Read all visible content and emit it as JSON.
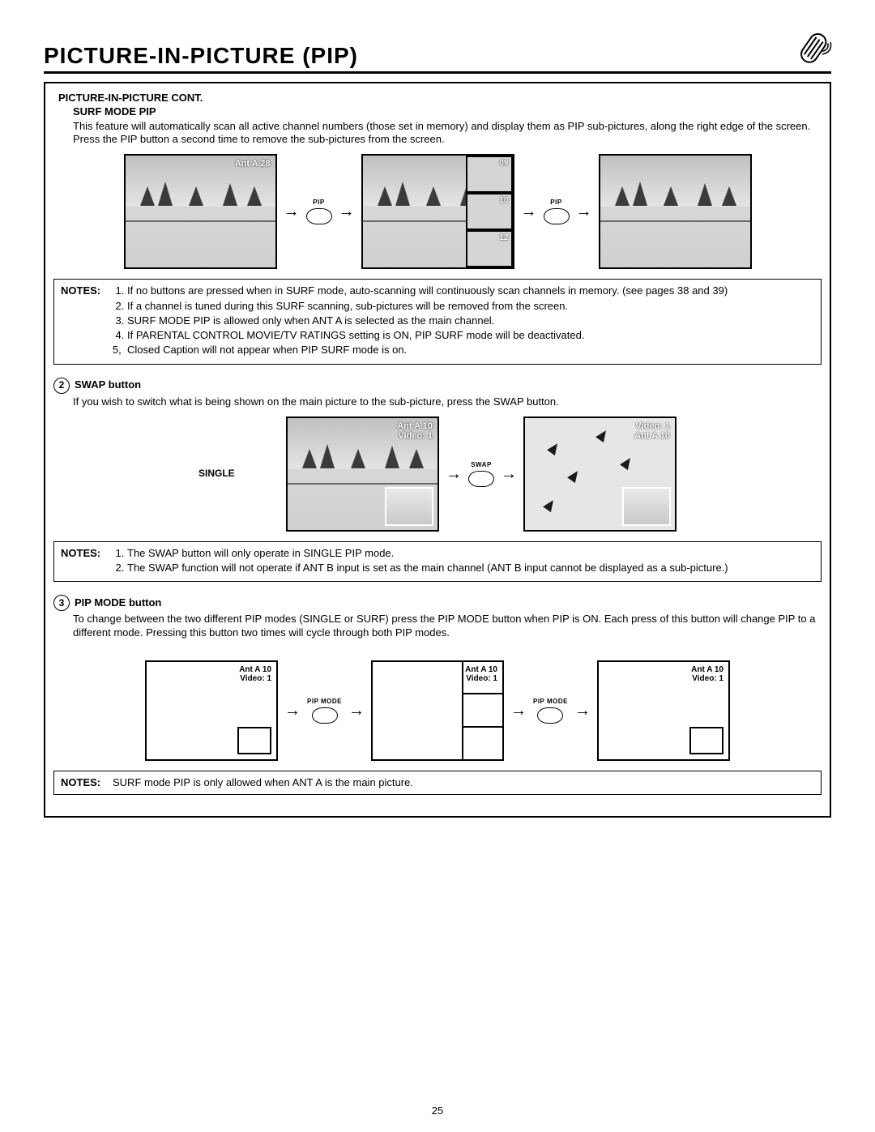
{
  "header": {
    "title": "PICTURE-IN-PICTURE (PIP)"
  },
  "section": {
    "heading": "PICTURE-IN-PICTURE CONT.",
    "subheading": "SURF MODE PIP",
    "intro": "This feature will automatically scan all active channel numbers (those set in memory) and display them as PIP sub-pictures, along the right edge of the screen.  Press the PIP button a second time to remove the sub-pictures from the screen."
  },
  "surf_fig": {
    "screen1_osd": "Ant A   28",
    "btn": "PIP",
    "strip": [
      "09",
      "10",
      "12"
    ]
  },
  "notes1": {
    "label": "NOTES:",
    "items": [
      "If no buttons are pressed when in SURF mode, auto-scanning will continuously scan channels in memory.  (see pages 38 and 39)",
      "If a channel is tuned during this SURF scanning, sub-pictures will be removed from the screen.",
      "SURF MODE PIP is allowed only when ANT A is selected as the main channel.",
      "If PARENTAL CONTROL MOVIE/TV RATINGS setting is ON, PIP SURF mode will be deactivated.",
      "Closed Caption will not appear when PIP SURF mode is on."
    ]
  },
  "swap": {
    "num": "2",
    "title": "SWAP button",
    "para": "If you wish to switch what is being shown on the main picture to the sub-picture, press the SWAP button.",
    "side": "SINGLE",
    "osd_a_line1": "Ant A 10",
    "osd_a_line2": "Video: 1",
    "osd_b_line1": "Video: 1",
    "osd_b_line2": "Ant  A 10",
    "btn": "SWAP"
  },
  "notes2": {
    "label": "NOTES:",
    "items": [
      "The SWAP button will only operate in SINGLE PIP mode.",
      "The SWAP function will not operate if ANT B input is set as the main channel (ANT B input cannot be displayed as a sub-picture.)"
    ]
  },
  "mode": {
    "num": "3",
    "title": "PIP MODE button",
    "para": "To change between the two different PIP modes (SINGLE or SURF) press the PIP MODE button when PIP is ON.  Each press of this button will change PIP to a different mode.  Pressing this button two times will cycle through both PIP modes.",
    "osd_line1": "Ant A 10",
    "osd_line2": "Video: 1",
    "btn": "PIP MODE"
  },
  "notes3": {
    "label": "NOTES:",
    "text": "SURF mode PIP is only allowed when ANT A is the main picture."
  },
  "page_number": "25"
}
